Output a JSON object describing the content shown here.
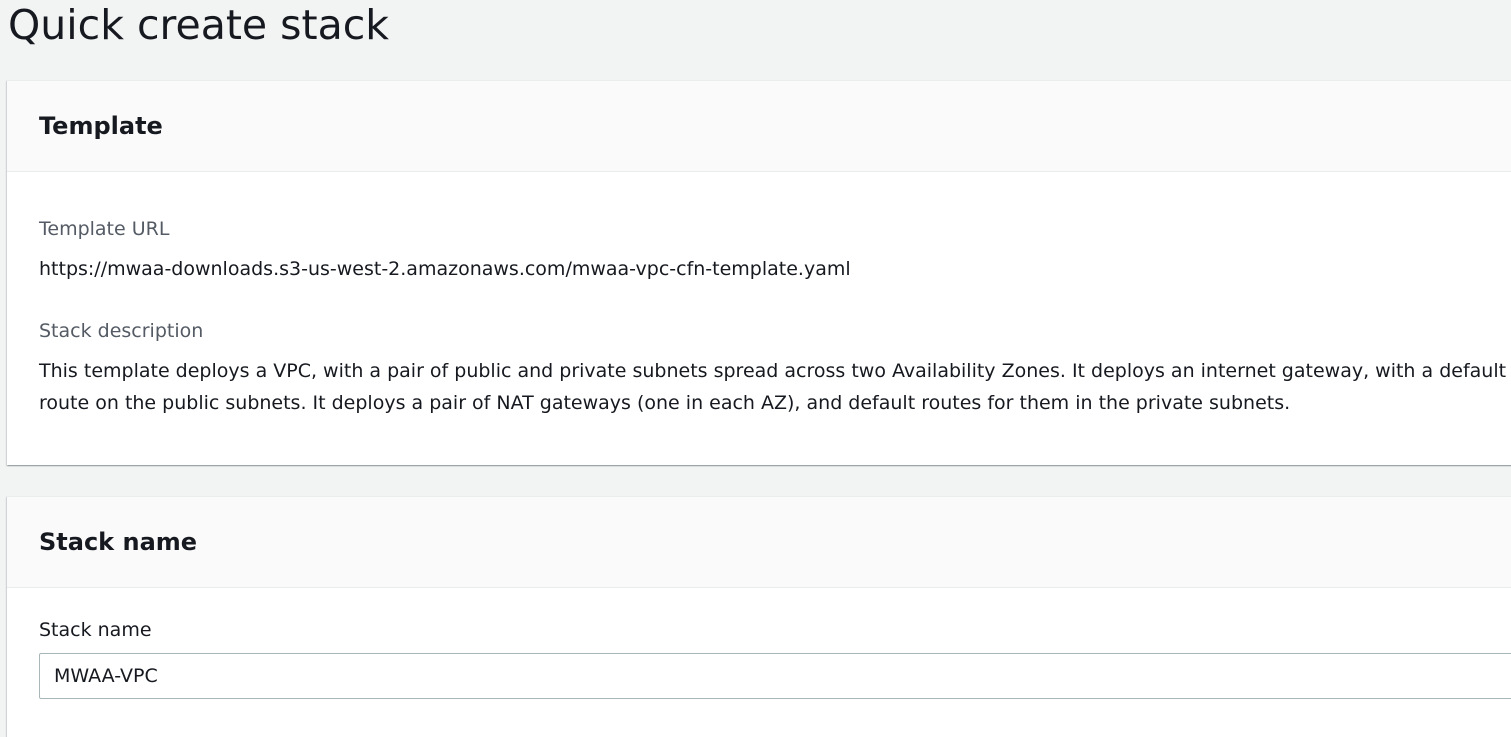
{
  "page": {
    "title": "Quick create stack"
  },
  "template_panel": {
    "header": "Template",
    "url_label": "Template URL",
    "url_value": "https://mwaa-downloads.s3-us-west-2.amazonaws.com/mwaa-vpc-cfn-template.yaml",
    "description_label": "Stack description",
    "description_value": "This template deploys a VPC, with a pair of public and private subnets spread across two Availability Zones. It deploys an internet gateway, with a default route on the public subnets. It deploys a pair of NAT gateways (one in each AZ), and default routes for them in the private subnets."
  },
  "stack_name_panel": {
    "header": "Stack name",
    "field_label": "Stack name",
    "field_value": "MWAA-VPC"
  },
  "colors": {
    "background": "#f2f3f3",
    "panel": "#ffffff",
    "panel_header": "#fafafa",
    "text": "#16191f",
    "label": "#545b64",
    "input_border": "#aab7b8"
  }
}
